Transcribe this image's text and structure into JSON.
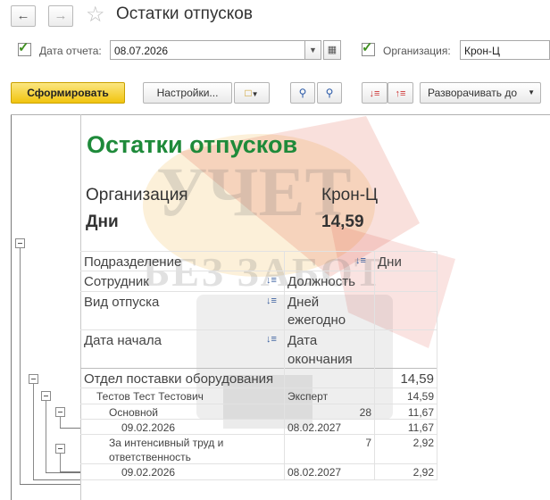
{
  "window": {
    "title": "Остатки отпусков"
  },
  "icons": {
    "back": "arrow-left-icon",
    "forward": "arrow-right-icon",
    "favorite": "star-icon"
  },
  "filters": {
    "date_label": "Дата отчета:",
    "date_value": "08.07.2026",
    "org_label": "Организация:",
    "org_value": "Крон-Ц"
  },
  "toolbar": {
    "generate": "Сформировать",
    "settings": "Настройки...",
    "expand": "Разворачивать до"
  },
  "report": {
    "title": "Остатки отпусков",
    "org_label": "Организация",
    "org_value": "Крон-Ц",
    "days_label": "Дни",
    "days_value": "14,59",
    "headers": {
      "h1": "Подразделение",
      "h1r": "Дни",
      "h2": "Сотрудник",
      "h2r": "Должность",
      "h3": "Вид отпуска",
      "h3r1": "Дней",
      "h3r2": "ежегодно",
      "h4": "Дата начала",
      "h4r1": "Дата",
      "h4r2": "окончания"
    },
    "rows": {
      "dept": "Отдел поставки оборудования",
      "dept_days": "14,59",
      "emp": "Тестов Тест Тестович",
      "emp_pos": "Эксперт",
      "emp_days": "14,59",
      "v1": "Основной",
      "v1_per_year": "28",
      "v1_days": "11,67",
      "v1_start": "09.02.2026",
      "v1_end": "08.02.2027",
      "v1_sub_days": "11,67",
      "v2a": "За интенсивный труд и",
      "v2b": "ответственность",
      "v2_per_year": "7",
      "v2_days": "2,92",
      "v2_start": "09.02.2026",
      "v2_end": "08.02.2027",
      "v2_sub_days": "2,92"
    }
  },
  "watermark": {
    "line1": "УЧЕТ",
    "line2": "БЕЗ ЗАБОТ"
  }
}
